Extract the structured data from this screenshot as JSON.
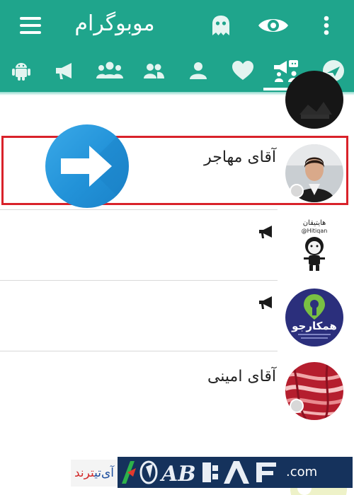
{
  "app": {
    "title": "موبوگرام",
    "accent_color": "#1fa58c",
    "highlight_color": "#d9222a",
    "arrow_badge_color": "#2292d8"
  },
  "toolbar": {
    "menu_icon": "hamburger-menu-icon",
    "ghost_icon": "ghost-icon",
    "eye_icon": "eye-icon",
    "more_icon": "more-vertical-icon"
  },
  "tabs": [
    {
      "name": "android-bots",
      "icon": "android-icon"
    },
    {
      "name": "channels",
      "icon": "megaphone-icon"
    },
    {
      "name": "supergroups",
      "icon": "group-three-icon"
    },
    {
      "name": "groups",
      "icon": "group-two-icon"
    },
    {
      "name": "contacts",
      "icon": "person-icon"
    },
    {
      "name": "favorites",
      "icon": "heart-icon"
    },
    {
      "name": "all",
      "icon": "all-chats-icon",
      "selected": true
    },
    {
      "name": "mobogram",
      "icon": "paper-plane-icon"
    }
  ],
  "chats": [
    {
      "name": "",
      "type": "unknown"
    },
    {
      "name": "آقای مهاجر",
      "type": "contact",
      "highlighted": true
    },
    {
      "name": "",
      "type": "channel",
      "avatar_text": "@Hitiqan"
    },
    {
      "name": "",
      "type": "channel",
      "avatar_text": "همکارجو"
    },
    {
      "name": "آقای امینی",
      "type": "contact"
    },
    {
      "name": "",
      "type": "unknown"
    }
  ],
  "watermark": {
    "left_text_a": "آی‌تی",
    "left_text_b": "ترند",
    "dotcom": ".com"
  }
}
